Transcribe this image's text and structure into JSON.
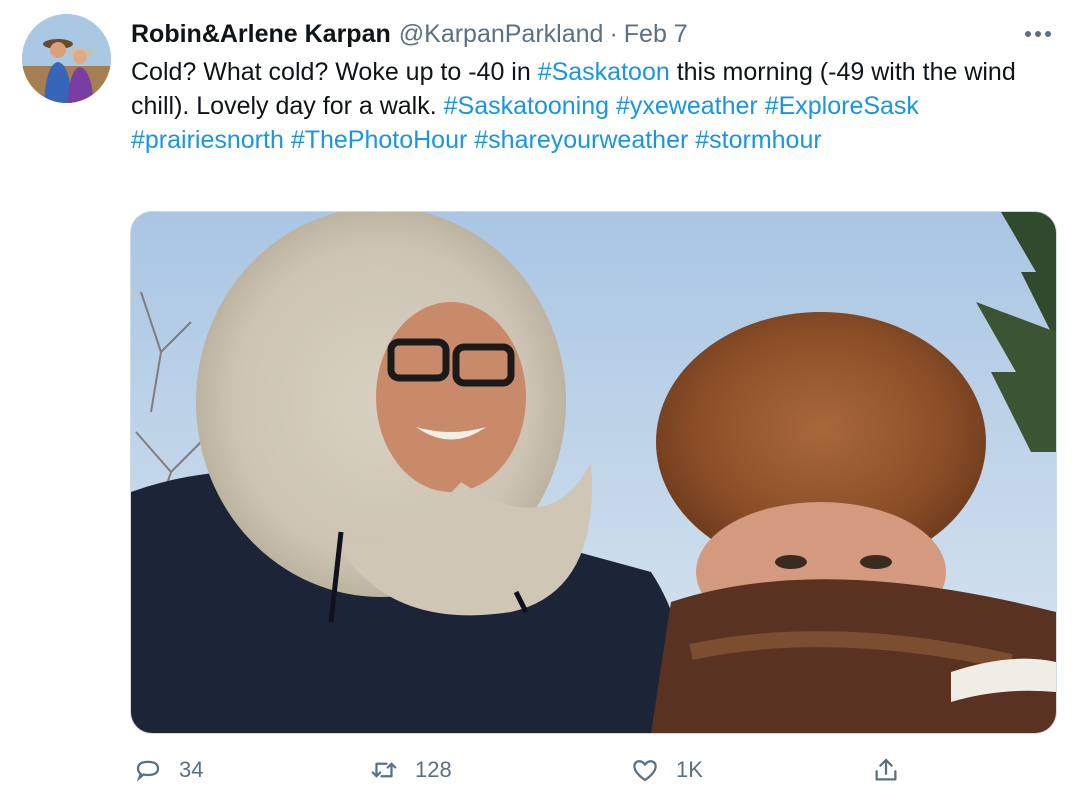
{
  "tweet": {
    "author": {
      "display_name": "Robin&Arlene Karpan",
      "handle": "@KarpanParkland"
    },
    "separator": "·",
    "timestamp": "Feb 7",
    "text": {
      "part1": "Cold? What cold? Woke up to -40 in ",
      "tag_saskatoon": "#Saskatoon",
      "part2": " this morning (-49 with the wind chill). Lovely day for a walk. ",
      "tag_saskatooning": "#Saskatooning",
      "tag_yxeweather": "#yxeweather",
      "tag_exploresask": "#ExploreSask",
      "tag_prairiesnorth": "#prairiesnorth",
      "tag_thephotohour": "#ThePhotoHour",
      "tag_shareyourweather": "#shareyourweather",
      "tag_stormhour": "#stormhour"
    },
    "actions": {
      "reply": {
        "icon": "reply-icon",
        "count": "34"
      },
      "retweet": {
        "icon": "retweet-icon",
        "count": "128"
      },
      "like": {
        "icon": "heart-icon",
        "count": "1K"
      },
      "share": {
        "icon": "share-icon"
      }
    },
    "icons": {
      "more": "more-icon"
    },
    "colors": {
      "hashtag": "#1b95e0",
      "secondary_text": "#5b7083",
      "primary_text": "#0f1419"
    }
  }
}
